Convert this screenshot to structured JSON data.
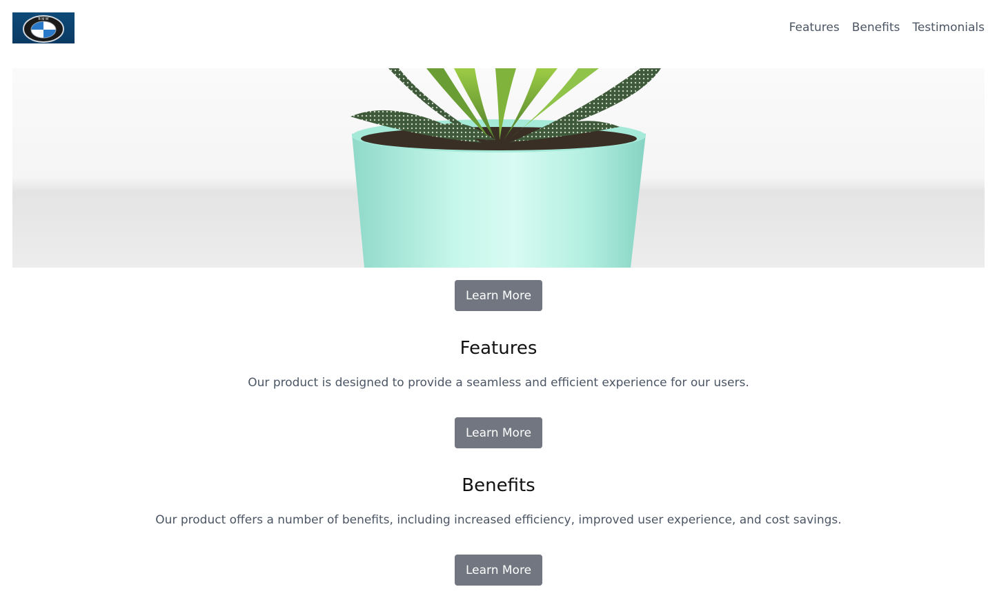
{
  "header": {
    "logo_icon": "bmw-roundel-logo",
    "nav": [
      {
        "label": "Features"
      },
      {
        "label": "Benefits"
      },
      {
        "label": "Testimonials"
      }
    ]
  },
  "hero": {
    "image": "succulent-in-mint-pot-photo"
  },
  "hero_cta": {
    "label": "Learn More"
  },
  "features": {
    "title": "Features",
    "text": "Our product is designed to provide a seamless and efficient experience for our users.",
    "cta": "Learn More"
  },
  "benefits": {
    "title": "Benefits",
    "text": "Our product offers a number of benefits, including increased efficiency, improved user experience, and cost savings.",
    "cta": "Learn More"
  },
  "colors": {
    "button_bg": "#717680",
    "nav_text": "#4b5563",
    "body_text": "#4b5563",
    "heading": "#111111",
    "pot": "#aeeee0"
  }
}
